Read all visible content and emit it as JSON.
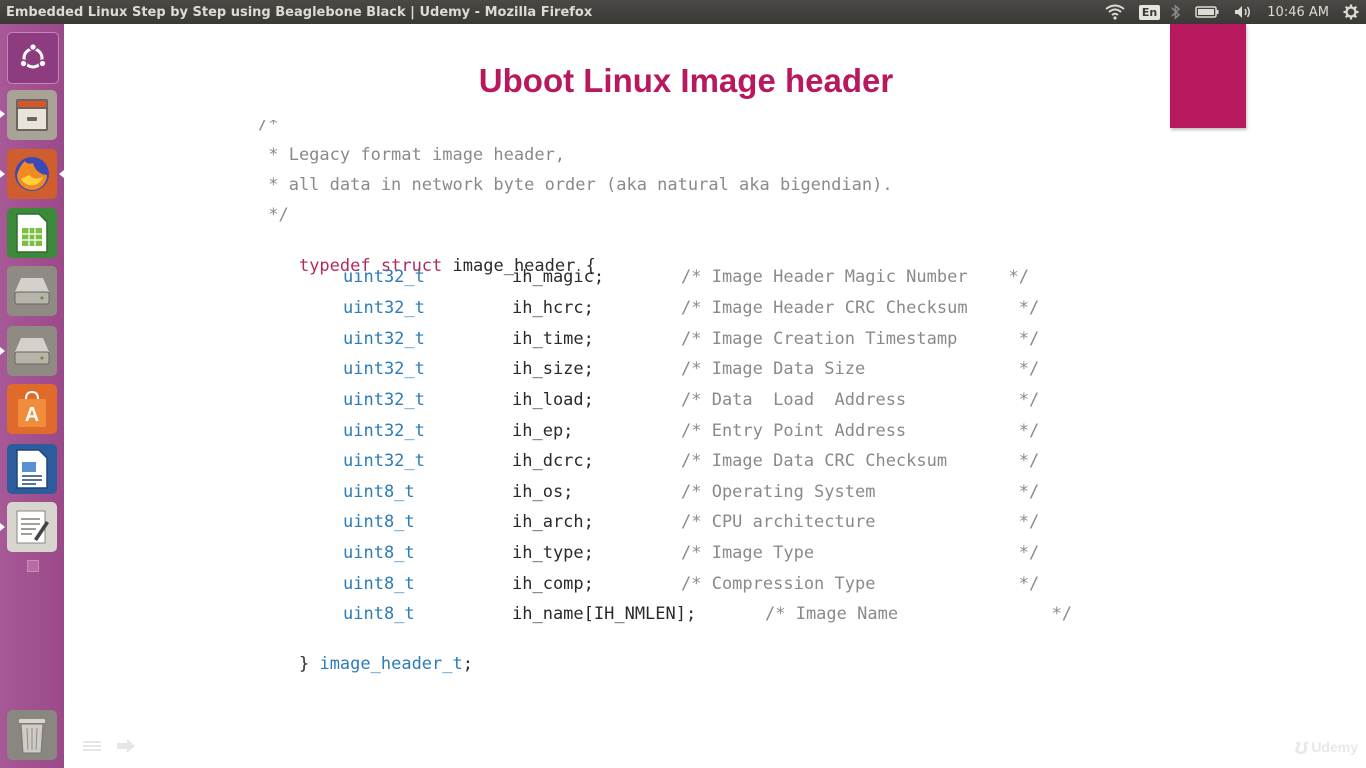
{
  "window": {
    "title": "Embedded Linux Step by Step using Beaglebone Black | Udemy - Mozilla Firefox"
  },
  "top_panel": {
    "keyboard_layout": "En",
    "clock": "10:46 AM",
    "icons": [
      "wifi-icon",
      "keyboard-layout-indicator",
      "bluetooth-icon",
      "battery-icon",
      "volume-icon",
      "settings-gear-icon"
    ]
  },
  "launcher": {
    "items": [
      {
        "name": "ubuntu-dash",
        "icon": "ubuntu-logo-icon"
      },
      {
        "name": "files",
        "icon": "file-cabinet-icon"
      },
      {
        "name": "firefox",
        "icon": "firefox-icon",
        "running": true
      },
      {
        "name": "libreoffice-calc",
        "icon": "spreadsheet-icon"
      },
      {
        "name": "drive-1",
        "icon": "hard-drive-icon"
      },
      {
        "name": "drive-2",
        "icon": "hard-drive-icon"
      },
      {
        "name": "software-center",
        "icon": "shopping-bag-icon"
      },
      {
        "name": "libreoffice-writer",
        "icon": "document-icon"
      },
      {
        "name": "text-editor",
        "icon": "text-editor-icon"
      },
      {
        "name": "trash",
        "icon": "trash-icon"
      }
    ]
  },
  "slide": {
    "title": "Uboot Linux Image header",
    "accent_color": "#b8195e",
    "comment_lines": [
      "/*",
      " * Legacy format image header,",
      " * all data in network byte order (aka natural aka bigendian).",
      " */"
    ],
    "typedef": {
      "keyword1": "typedef",
      "keyword2": "struct",
      "name": "image_header",
      "open": "{",
      "close": "}",
      "alias": "image_header_t",
      "terminator": ";"
    },
    "fields": [
      {
        "type": "uint32_t",
        "name": "ih_magic;",
        "comment": "/* Image Header Magic Number    */"
      },
      {
        "type": "uint32_t",
        "name": "ih_hcrc;",
        "comment": "/* Image Header CRC Checksum     */"
      },
      {
        "type": "uint32_t",
        "name": "ih_time;",
        "comment": "/* Image Creation Timestamp      */"
      },
      {
        "type": "uint32_t",
        "name": "ih_size;",
        "comment": "/* Image Data Size               */"
      },
      {
        "type": "uint32_t",
        "name": "ih_load;",
        "comment": "/* Data  Load  Address           */"
      },
      {
        "type": "uint32_t",
        "name": "ih_ep;",
        "comment": "/* Entry Point Address           */"
      },
      {
        "type": "uint32_t",
        "name": "ih_dcrc;",
        "comment": "/* Image Data CRC Checksum       */"
      },
      {
        "type": "uint8_t",
        "name": "ih_os;",
        "comment": "/* Operating System              */"
      },
      {
        "type": "uint8_t",
        "name": "ih_arch;",
        "comment": "/* CPU architecture              */"
      },
      {
        "type": "uint8_t",
        "name": "ih_type;",
        "comment": "/* Image Type                    */"
      },
      {
        "type": "uint8_t",
        "name": "ih_comp;",
        "comment": "/* Compression Type              */"
      },
      {
        "type": "uint8_t",
        "name": "ih_name[IH_NMLEN];",
        "comment": "/* Image Name               */",
        "comment_shift": true
      }
    ]
  },
  "watermark": {
    "text": "Udemy"
  }
}
